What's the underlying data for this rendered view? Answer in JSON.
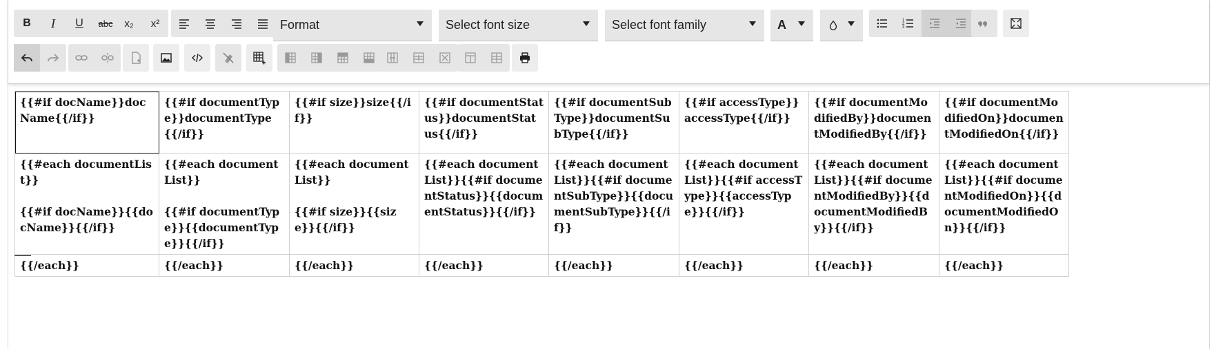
{
  "toolbar": {
    "format": {
      "bold": "B",
      "italic": "I",
      "underline": "U",
      "strike": "abc",
      "subscript": "x₂",
      "superscript": "x²"
    },
    "selects": {
      "format": "Format",
      "font_size": "Select font size",
      "font_family": "Select font family",
      "text_color": "A"
    },
    "icons": {
      "row1": [
        "bold-icon",
        "italic-icon",
        "underline-icon",
        "strikethrough-icon",
        "subscript-icon",
        "superscript-icon",
        "align-left-icon",
        "align-center-icon",
        "align-right-icon",
        "justify-icon",
        "text-color-icon",
        "highlight-color-icon",
        "bullet-list-icon",
        "numbered-list-icon",
        "outdent-icon",
        "indent-icon",
        "blockquote-icon",
        "fullscreen-icon"
      ],
      "row2": [
        "undo-icon",
        "redo-icon",
        "link-icon",
        "unlink-icon",
        "insert-file-icon",
        "insert-image-icon",
        "source-code-icon",
        "clear-format-icon",
        "insert-table-icon",
        "insert-column-before-icon",
        "insert-column-after-icon",
        "insert-row-above-icon",
        "insert-row-below-icon",
        "merge-columns-icon",
        "merge-rows-icon",
        "delete-cell-icon",
        "split-column-icon",
        "split-row-icon",
        "print-icon"
      ]
    }
  },
  "table": {
    "rows": [
      [
        "{{#if docName}}docName{{/if}}",
        "{{#if documentType}}documentType{{/if}}",
        "{{#if size}}size{{/if}}",
        "{{#if documentStatus}}documentStatus{{/if}}",
        "{{#if documentSubType}}documentSubType{{/if}}",
        "{{#if accessType}}accessType{{/if}}",
        "{{#if documentModifiedBy}}documentModifiedBy{{/if}}",
        "{{#if documentModifiedOn}}documentModifiedOn{{/if}}"
      ],
      [
        "{{#each documentList}}\n\n{{#if docName}}{{docName}}{{/if}}",
        "{{#each documentList}}\n\n{{#if documentType}}{{documentType}}{{/if}}",
        "{{#each documentList}}\n\n{{#if size}}{{size}}{{/if}}",
        "{{#each documentList}}{{#if documentStatus}}{{documentStatus}}{{/if}}",
        "{{#each documentList}}{{#if documentSubType}}{{documentSubType}}{{/if}}",
        "{{#each documentList}}{{#if accessType}}{{accessType}}{{/if}}",
        "{{#each documentList}}{{#if documentModifiedBy}}{{documentModifiedBy}}{{/if}}",
        "{{#each documentList}}{{#if documentModifiedOn}}{{documentModifiedOn}}{{/if}}"
      ],
      [
        "{{/each}}",
        "{{/each}}",
        "{{/each}}",
        "{{/each}}",
        "{{/each}}",
        "{{/each}}",
        "{{/each}}",
        "{{/each}}"
      ]
    ]
  }
}
